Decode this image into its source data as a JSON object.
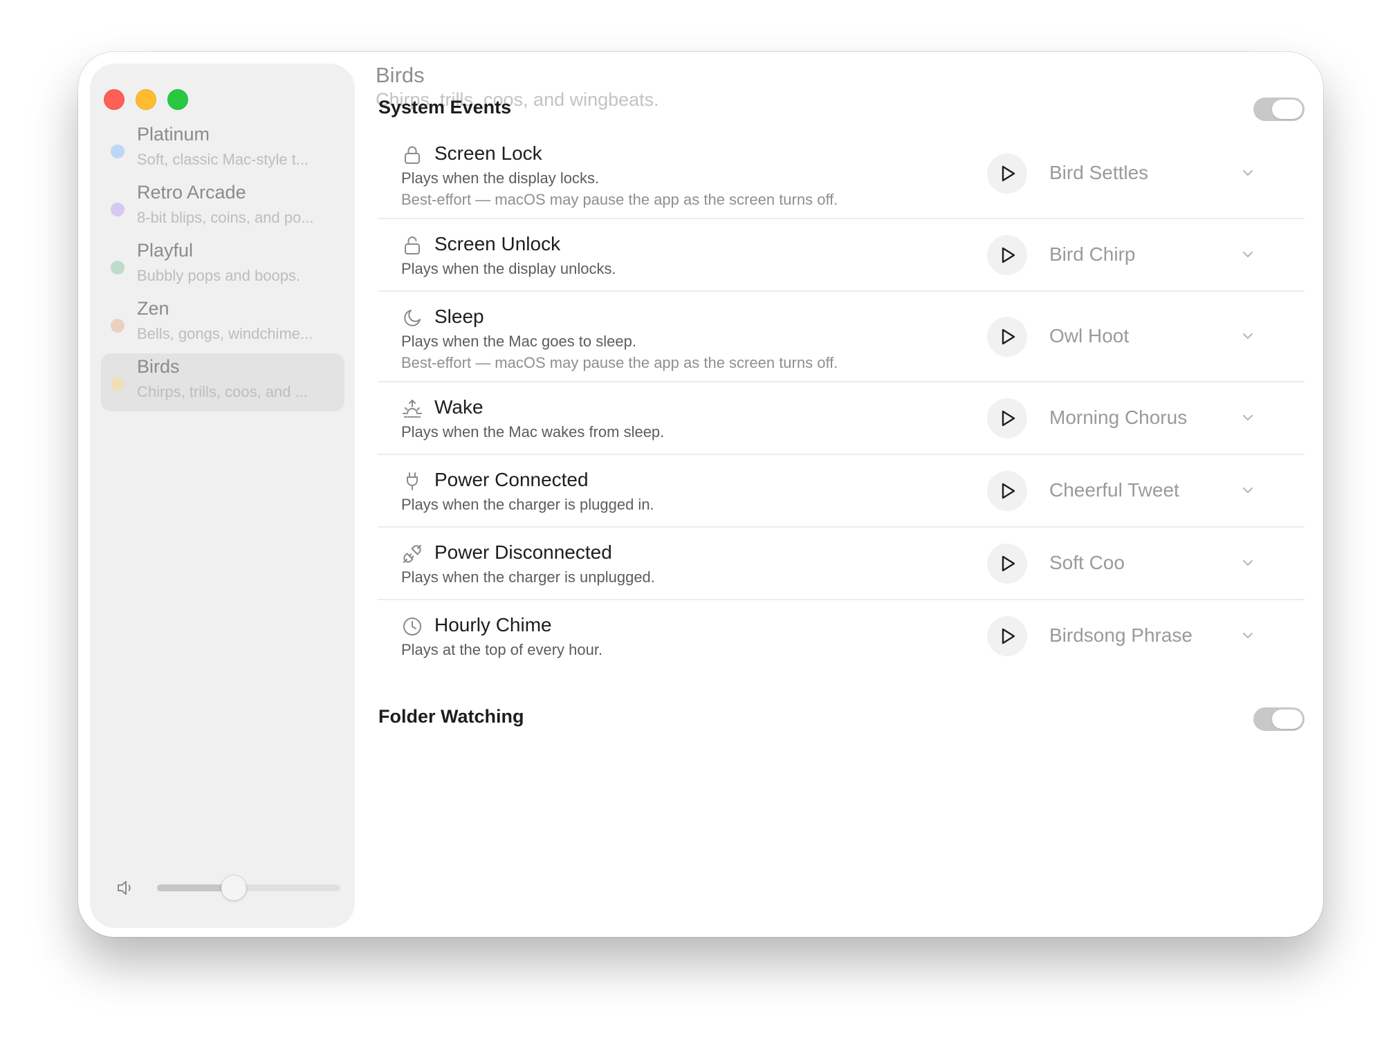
{
  "themes": [
    {
      "name": "Platinum",
      "description": "Soft, classic Mac-style t...",
      "dot_color": "#bcd7f3"
    },
    {
      "name": "Retro Arcade",
      "description": "8-bit blips, coins, and po...",
      "dot_color": "#d5c9f0"
    },
    {
      "name": "Playful",
      "description": "Bubbly pops and boops.",
      "dot_color": "#bfdbcc"
    },
    {
      "name": "Zen",
      "description": "Bells, gongs, windchime...",
      "dot_color": "#ecd0bf"
    },
    {
      "name": "Birds",
      "description": "Chirps, trills, coos, and ...",
      "dot_color": "#f0e0b8"
    }
  ],
  "selected_theme_index": 4,
  "volume_level": 0.42,
  "main": {
    "title": "Birds",
    "subtitle": "Chirps, trills, coos, and wingbeats.",
    "system_events": {
      "title": "System Events",
      "enabled": true,
      "events": [
        {
          "name": "Screen Lock",
          "icon": "lock-icon",
          "description": "Plays when the display locks.",
          "note": "Best-effort — macOS may pause the app as the screen turns off.",
          "sound": "Bird Settles"
        },
        {
          "name": "Screen Unlock",
          "icon": "unlock-icon",
          "description": "Plays when the display unlocks.",
          "note": "",
          "sound": "Bird Chirp"
        },
        {
          "name": "Sleep",
          "icon": "moon-icon",
          "description": "Plays when the Mac goes to sleep.",
          "note": "Best-effort — macOS may pause the app as the screen turns off.",
          "sound": "Owl Hoot"
        },
        {
          "name": "Wake",
          "icon": "sunrise-icon",
          "description": "Plays when the Mac wakes from sleep.",
          "note": "",
          "sound": "Morning Chorus"
        },
        {
          "name": "Power Connected",
          "icon": "plug-icon",
          "description": "Plays when the charger is plugged in.",
          "note": "",
          "sound": "Cheerful Tweet"
        },
        {
          "name": "Power Disconnected",
          "icon": "plug-disconnected-icon",
          "description": "Plays when the charger is unplugged.",
          "note": "",
          "sound": "Soft Coo"
        },
        {
          "name": "Hourly Chime",
          "icon": "clock-icon",
          "description": "Plays at the top of every hour.",
          "note": "",
          "sound": "Birdsong Phrase"
        }
      ]
    },
    "folder_watching": {
      "title": "Folder Watching",
      "enabled": true
    }
  },
  "icons": {
    "play": "play-icon",
    "chevron": "chevron-down-icon",
    "volume": "speaker-icon"
  }
}
